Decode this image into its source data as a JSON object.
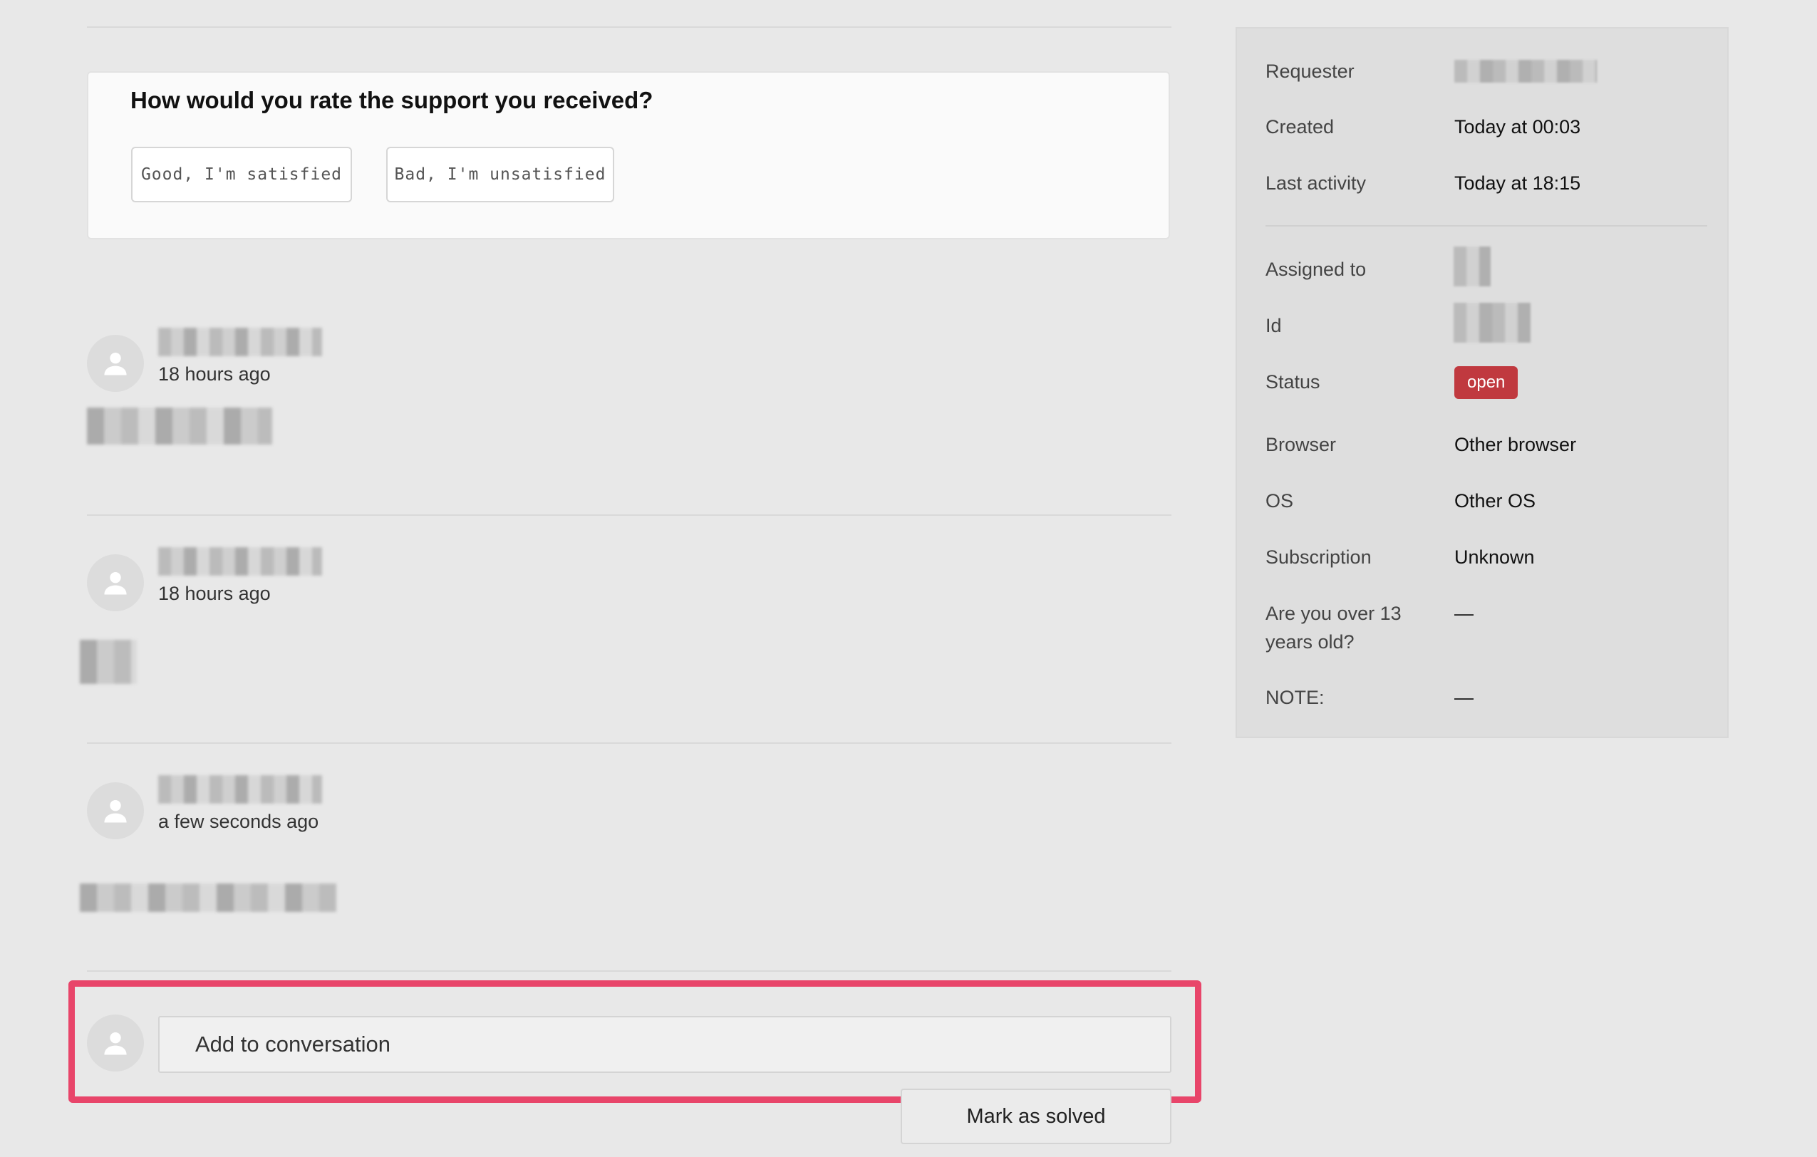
{
  "rating": {
    "question": "How would you rate the support you received?",
    "good_label": "Good, I'm satisfied",
    "bad_label": "Bad, I'm unsatisfied"
  },
  "messages": [
    {
      "time": "18 hours ago"
    },
    {
      "time": "18 hours ago"
    },
    {
      "time": "a few seconds ago"
    }
  ],
  "compose": {
    "placeholder": "Add to conversation",
    "solve_label": "Mark as solved"
  },
  "sidebar": {
    "requester_label": "Requester",
    "created_label": "Created",
    "created_value": "Today at 00:03",
    "last_activity_label": "Last activity",
    "last_activity_value": "Today at 18:15",
    "assigned_label": "Assigned to",
    "id_label": "Id",
    "status_label": "Status",
    "status_value": "open",
    "browser_label": "Browser",
    "browser_value": "Other browser",
    "os_label": "OS",
    "os_value": "Other OS",
    "subscription_label": "Subscription",
    "subscription_value": "Unknown",
    "age_label": "Are you over 13 years old?",
    "age_value": "—",
    "note_label": "NOTE:",
    "note_value": "—"
  },
  "colors": {
    "status_open": "#c0393f",
    "highlight": "#e8456a",
    "background": "#e8e8e8"
  }
}
